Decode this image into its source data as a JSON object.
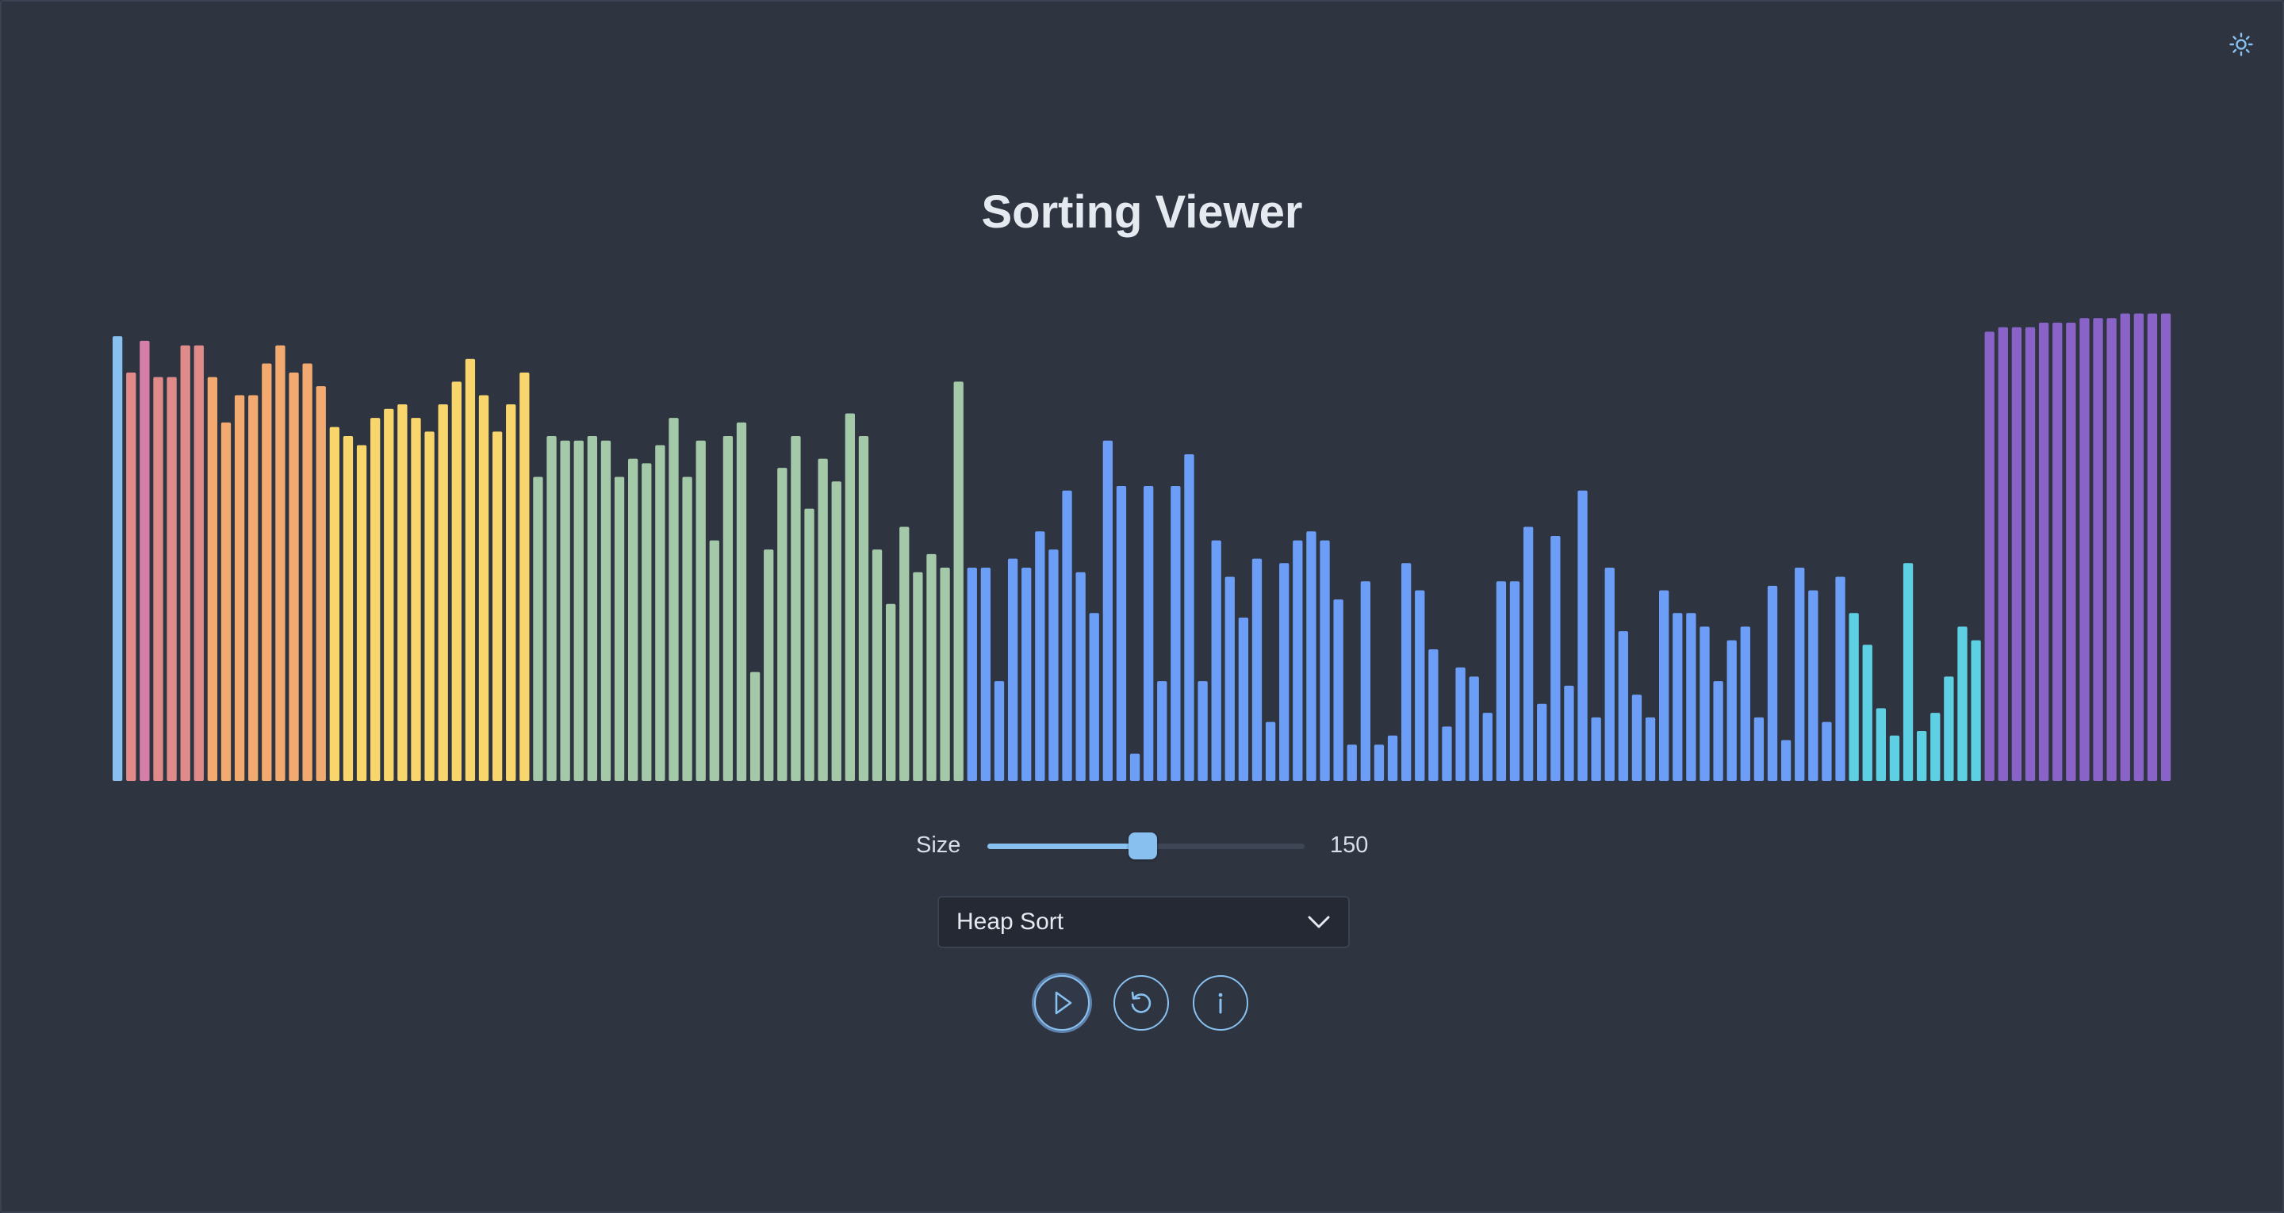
{
  "app": {
    "title": "Sorting Viewer"
  },
  "colors": {
    "background": "#2e3440",
    "accent": "#88c0f0",
    "compare": "#88c0f0",
    "pink": "#d57fa8",
    "red": "#e08a8a",
    "orange": "#f2aa70",
    "yellow": "#f8d66c",
    "green": "#a3c9a8",
    "blue": "#6c9ef8",
    "cyan": "#5ed0e4",
    "sorted": "#8a63c8"
  },
  "icons": {
    "theme_toggle": "sun-icon",
    "play": "play-icon",
    "reset": "reset-icon",
    "info": "info-icon",
    "dropdown": "chevron-down-icon"
  },
  "controls": {
    "size_label": "Size",
    "size_value": "150",
    "size_fraction": 0.49,
    "algorithm": "Heap Sort"
  },
  "chart_data": {
    "type": "bar",
    "max": 100,
    "values": [
      98,
      90,
      97,
      89,
      89,
      96,
      96,
      89,
      79,
      85,
      85,
      92,
      96,
      90,
      92,
      87,
      78,
      76,
      74,
      80,
      82,
      83,
      80,
      77,
      83,
      88,
      93,
      85,
      77,
      83,
      90,
      67,
      76,
      75,
      75,
      76,
      75,
      67,
      71,
      70,
      74,
      80,
      67,
      75,
      53,
      76,
      79,
      24,
      51,
      69,
      76,
      60,
      71,
      66,
      81,
      76,
      51,
      39,
      56,
      46,
      50,
      47,
      88,
      47,
      47,
      22,
      49,
      47,
      55,
      51,
      64,
      46,
      37,
      75,
      65,
      6,
      65,
      22,
      65,
      72,
      22,
      53,
      45,
      36,
      49,
      13,
      48,
      53,
      55,
      53,
      40,
      8,
      44,
      8,
      10,
      48,
      42,
      29,
      12,
      25,
      23,
      15,
      44,
      44,
      56,
      17,
      54,
      21,
      64,
      14,
      47,
      33,
      19,
      14,
      42,
      37,
      37,
      34,
      22,
      31,
      34,
      14,
      43,
      9,
      47,
      42,
      13,
      45,
      37,
      30,
      16,
      10,
      48,
      11,
      15,
      23,
      34,
      31,
      99,
      100,
      100,
      100,
      101,
      101,
      101,
      102,
      102,
      102,
      103,
      103,
      103,
      103
    ],
    "groups": [
      {
        "from": 0,
        "to": 0,
        "color": "compare"
      },
      {
        "from": 1,
        "to": 1,
        "color": "red"
      },
      {
        "from": 2,
        "to": 2,
        "color": "pink"
      },
      {
        "from": 3,
        "to": 6,
        "color": "red"
      },
      {
        "from": 7,
        "to": 15,
        "color": "orange"
      },
      {
        "from": 16,
        "to": 30,
        "color": "yellow"
      },
      {
        "from": 31,
        "to": 62,
        "color": "green"
      },
      {
        "from": 63,
        "to": 127,
        "color": "blue"
      },
      {
        "from": 128,
        "to": 137,
        "color": "cyan"
      },
      {
        "from": 138,
        "to": 151,
        "color": "sorted"
      }
    ]
  }
}
